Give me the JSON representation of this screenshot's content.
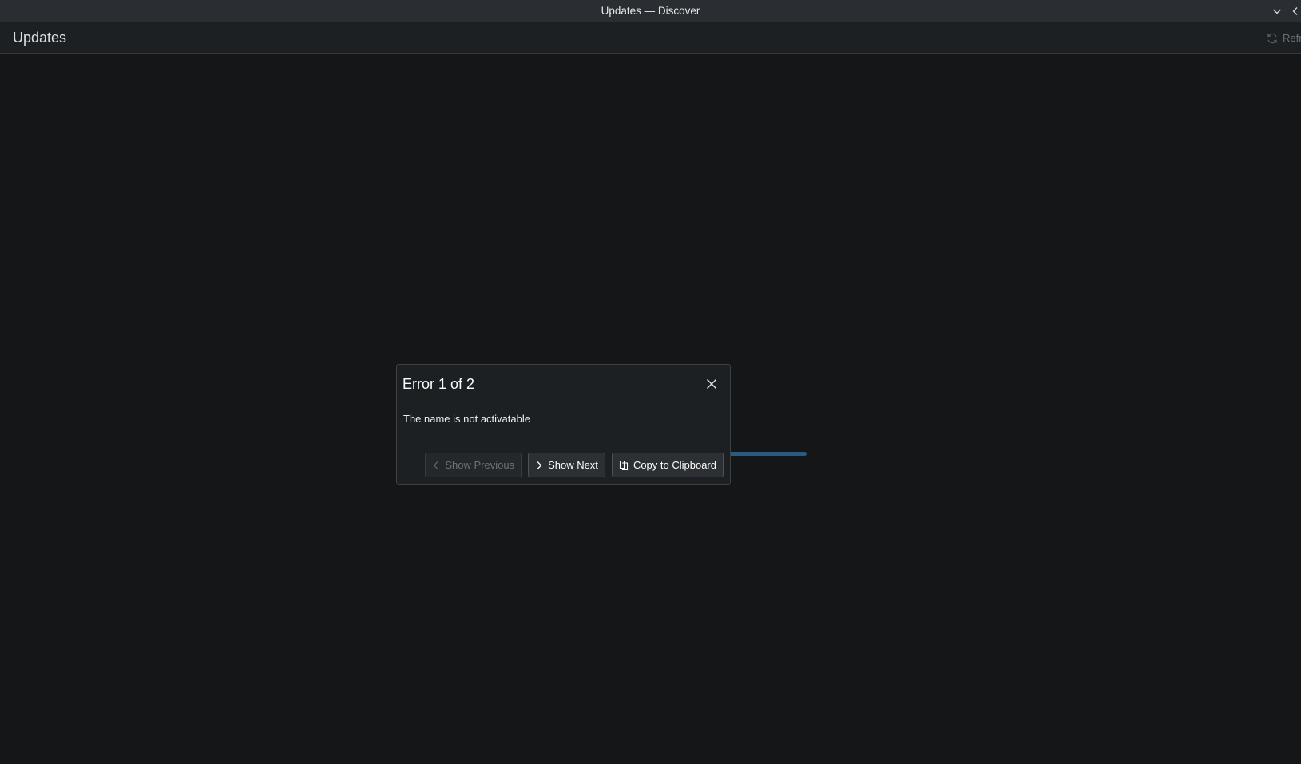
{
  "window": {
    "title": "Updates — Discover"
  },
  "header": {
    "page_title": "Updates",
    "refresh_label": "Refresh"
  },
  "progress": {
    "fraction": 1.0
  },
  "dialog": {
    "title": "Error 1 of 2",
    "message": "The name is not activatable",
    "buttons": {
      "previous": "Show Previous",
      "next": "Show Next",
      "copy": "Copy to Clipboard"
    }
  },
  "colors": {
    "background": "#141618",
    "titlebar": "#2a2e32",
    "header": "#1d2023",
    "progress": "#2a5a80"
  },
  "icons": {
    "close": "close-icon",
    "previous": "chevron-left-icon",
    "next": "chevron-right-icon",
    "copy": "copy-icon",
    "refresh": "refresh-icon",
    "minimize": "chevron-down-icon",
    "keep-above": "chevron-left-icon"
  }
}
